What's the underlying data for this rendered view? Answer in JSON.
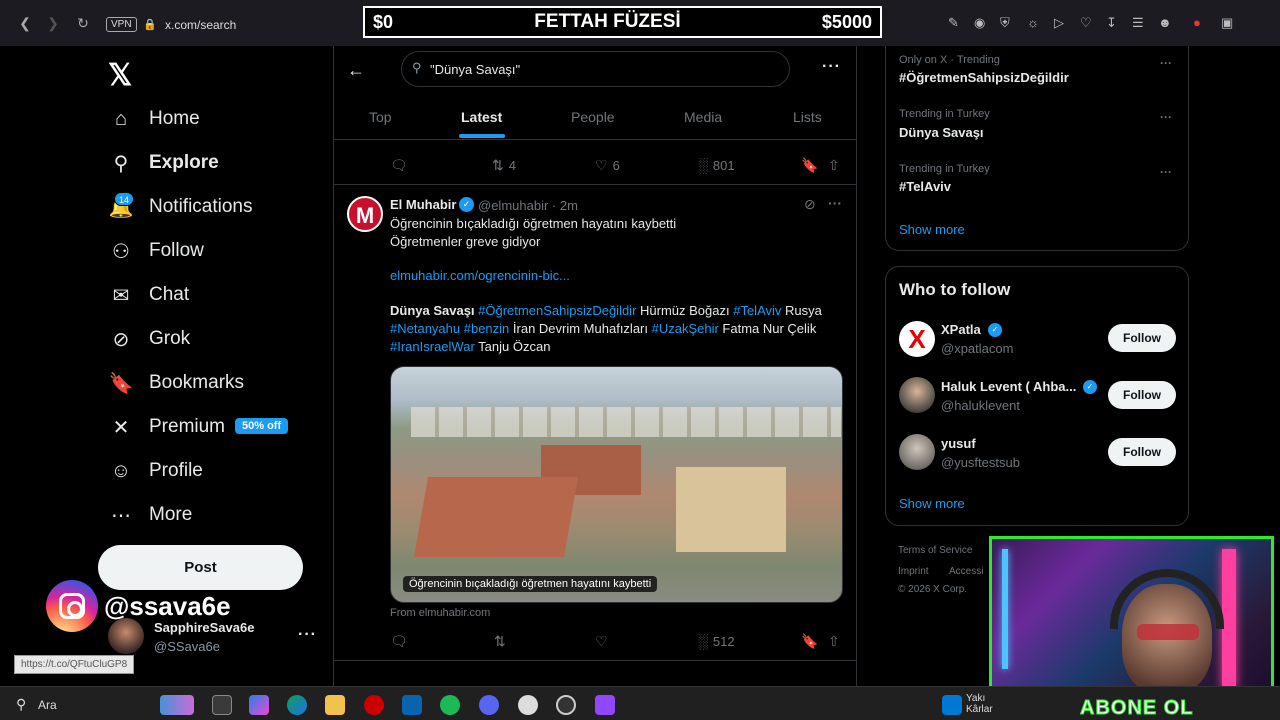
{
  "browser": {
    "vpn_label": "VPN",
    "url": "x.com/search",
    "status_url": "https://t.co/QFtuCluGP8"
  },
  "overlay": {
    "left": "$0",
    "title": "FETTAH FÜZESİ",
    "right": "$5000",
    "instagram_handle": "@ssava6e",
    "webcam_text": "ABONE OL"
  },
  "nav": {
    "items": [
      {
        "label": "Home",
        "icon": "home-icon"
      },
      {
        "label": "Explore",
        "icon": "search-icon"
      },
      {
        "label": "Notifications",
        "icon": "bell-icon"
      },
      {
        "label": "Follow",
        "icon": "add-user-icon"
      },
      {
        "label": "Chat",
        "icon": "mail-icon"
      },
      {
        "label": "Grok",
        "icon": "grok-icon"
      },
      {
        "label": "Bookmarks",
        "icon": "bookmark-icon"
      },
      {
        "label": "Premium",
        "icon": "x-icon"
      },
      {
        "label": "Profile",
        "icon": "person-icon"
      },
      {
        "label": "More",
        "icon": "more-circle-icon"
      }
    ],
    "notif_count": "14",
    "premium_badge": "50% off",
    "post_label": "Post",
    "account": {
      "name": "SapphireSava6e",
      "handle": "@SSava6e"
    }
  },
  "search": {
    "query": "\"Dünya Savaşı\"",
    "tabs": [
      "Top",
      "Latest",
      "People",
      "Media",
      "Lists"
    ],
    "active_tab": "Latest"
  },
  "prev_tweet_actions": {
    "retweets": "4",
    "likes": "6",
    "views": "801"
  },
  "tweet": {
    "author": "El Muhabir",
    "handle": "@elmuhabir",
    "time": "· 2m",
    "line1": "Öğrencinin bıçakladığı öğretmen hayatını kaybetti",
    "line2": "Öğretmenler greve gidiyor",
    "link": "elmuhabir.com/ogrencinin-bic...",
    "tags_line1": {
      "a": "Dünya Savaşı",
      "b": " #ÖğretmenSahipsizDeğildir",
      "c": " Hürmüz Boğazı",
      "d": " #TelAviv",
      "e": " Rusya"
    },
    "tags_line2": {
      "a": "#Netanyahu",
      "b": " #benzin",
      "c": " İran Devrim Muhafızları",
      "d": " #UzakŞehir",
      "e": " Fatma Nur Çelik"
    },
    "tags_line3": {
      "a": "#IranIsraelWar",
      "b": " Tanju Özcan"
    },
    "image_caption": "Öğrencinin bıçakladığı öğretmen hayatını kaybetti",
    "from": "From elmuhabir.com",
    "views": "512"
  },
  "trends": [
    {
      "meta": "Only on X · Trending",
      "name": "#ÖğretmenSahipsizDeğildir"
    },
    {
      "meta": "Trending in Turkey",
      "name": "Dünya Savaşı"
    },
    {
      "meta": "Trending in Turkey",
      "name": "#TelAviv"
    }
  ],
  "show_more": "Show more",
  "who_to_follow": {
    "title": "Who to follow",
    "users": [
      {
        "name": "XPatla",
        "handle": "@xpatlacom",
        "verified": true
      },
      {
        "name": "Haluk Levent ( Ahba...",
        "handle": "@haluklevent",
        "verified": true
      },
      {
        "name": "yusuf",
        "handle": "@yusftestsub",
        "verified": false
      }
    ],
    "follow_label": "Follow"
  },
  "footer": {
    "terms": "Terms of Service",
    "imprint": "Imprint",
    "access": "Accessi",
    "copyright": "© 2026 X Corp."
  },
  "taskbar": {
    "search": "Ara",
    "news1": "Yakı",
    "news2": "Kârlar"
  },
  "colors": {
    "accent": "#1d9bf0",
    "background": "#000000",
    "border": "#2f3336",
    "muted": "#71767b"
  }
}
